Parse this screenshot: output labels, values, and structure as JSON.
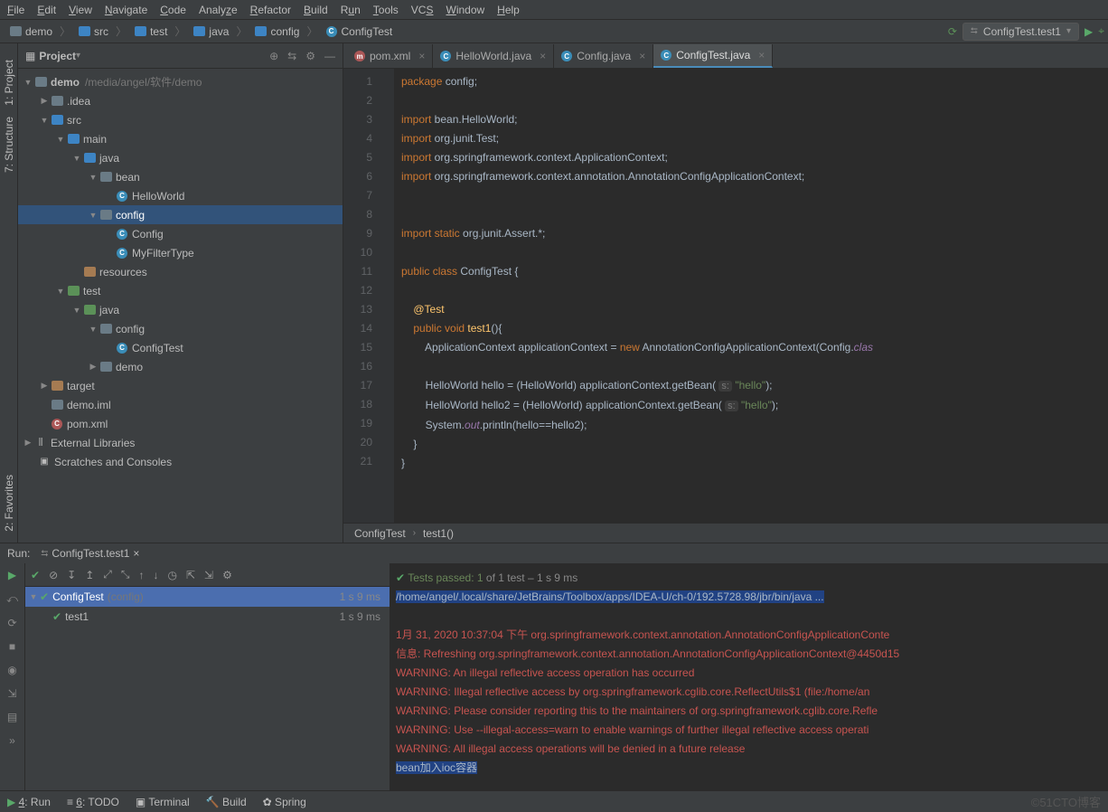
{
  "menu": [
    "File",
    "Edit",
    "View",
    "Navigate",
    "Code",
    "Analyze",
    "Refactor",
    "Build",
    "Run",
    "Tools",
    "VCS",
    "Window",
    "Help"
  ],
  "crumbs": [
    {
      "ic": "fold",
      "t": "demo"
    },
    {
      "ic": "fold b",
      "t": "src"
    },
    {
      "ic": "fold b",
      "t": "test"
    },
    {
      "ic": "fold b",
      "t": "java"
    },
    {
      "ic": "fold b",
      "t": "config"
    },
    {
      "ic": "cir cy",
      "t": "ConfigTest"
    }
  ],
  "run_config": "ConfigTest.test1",
  "sidebar_title": "Project",
  "left_tabs": [
    "1: Project",
    "7: Structure",
    "2: Favorites"
  ],
  "proj_root": {
    "name": "demo",
    "path": "/media/angel/软件/demo"
  },
  "tree": [
    {
      "d": 1,
      "t": "b",
      "i": "fold",
      "l": ".idea"
    },
    {
      "d": 1,
      "t": "e",
      "i": "fold b",
      "l": "src"
    },
    {
      "d": 2,
      "t": "e",
      "i": "fold b",
      "l": "main"
    },
    {
      "d": 3,
      "t": "e",
      "i": "fold b",
      "l": "java"
    },
    {
      "d": 4,
      "t": "e",
      "i": "fold",
      "l": "bean"
    },
    {
      "d": 5,
      "t": "",
      "i": "cir cy",
      "l": "HelloWorld"
    },
    {
      "d": 4,
      "t": "e",
      "i": "fold",
      "l": "config",
      "sel": true
    },
    {
      "d": 5,
      "t": "",
      "i": "cir cy",
      "l": "Config"
    },
    {
      "d": 5,
      "t": "",
      "i": "cir cy",
      "l": "MyFilterType"
    },
    {
      "d": 3,
      "t": "",
      "i": "fold o",
      "l": "resources"
    },
    {
      "d": 2,
      "t": "e",
      "i": "fold g",
      "l": "test"
    },
    {
      "d": 3,
      "t": "e",
      "i": "fold g",
      "l": "java"
    },
    {
      "d": 4,
      "t": "e",
      "i": "fold",
      "l": "config"
    },
    {
      "d": 5,
      "t": "",
      "i": "cir cy",
      "l": "ConfigTest"
    },
    {
      "d": 4,
      "t": "b",
      "i": "fold",
      "l": "demo"
    },
    {
      "d": 1,
      "t": "b",
      "i": "fold o",
      "l": "target"
    },
    {
      "d": 1,
      "t": "",
      "i": "fold",
      "l": "demo.iml"
    },
    {
      "d": 1,
      "t": "",
      "i": "cir m",
      "l": "pom.xml"
    }
  ],
  "ext_lib": "External Libraries",
  "scratch": "Scratches and Consoles",
  "tabs": [
    {
      "ic": "cir m",
      "l": "pom.xml"
    },
    {
      "ic": "cir cy",
      "l": "HelloWorld.java"
    },
    {
      "ic": "cir cy",
      "l": "Config.java"
    },
    {
      "ic": "cir cy",
      "l": "ConfigTest.java",
      "a": true
    }
  ],
  "lines": 21,
  "crumb2": [
    "ConfigTest",
    "test1()"
  ],
  "run_title": "Run:",
  "run_tab": "ConfigTest.test1",
  "tests_status": {
    "pre": "Tests passed: ",
    "num": "1",
    "post": " of 1 test – 1 s 9 ms"
  },
  "test_root": {
    "name": "ConfigTest",
    "pkg": "(config)",
    "time": "1 s 9 ms"
  },
  "test_leaf": {
    "name": "test1",
    "time": "1 s 9 ms"
  },
  "out_cmd": "/home/angel/.local/share/JetBrains/Toolbox/apps/IDEA-U/ch-0/192.5728.98/jbr/bin/java ...",
  "out_lines": [
    "1月 31, 2020 10:37:04 下午 org.springframework.context.annotation.AnnotationConfigApplicationConte",
    "信息: Refreshing org.springframework.context.annotation.AnnotationConfigApplicationContext@4450d15",
    "WARNING: An illegal reflective access operation has occurred",
    "WARNING: Illegal reflective access by org.springframework.cglib.core.ReflectUtils$1 (file:/home/an",
    "WARNING: Please consider reporting this to the maintainers of org.springframework.cglib.core.Refle",
    "WARNING: Use --illegal-access=warn to enable warnings of further illegal reflective access operati",
    "WARNING: All illegal access operations will be denied in a future release"
  ],
  "out_hl": "bean加入ioc容器",
  "status_items": [
    "4: Run",
    "6: TODO",
    "Terminal",
    "Build",
    "Spring"
  ],
  "watermark": "©51CTO博客"
}
